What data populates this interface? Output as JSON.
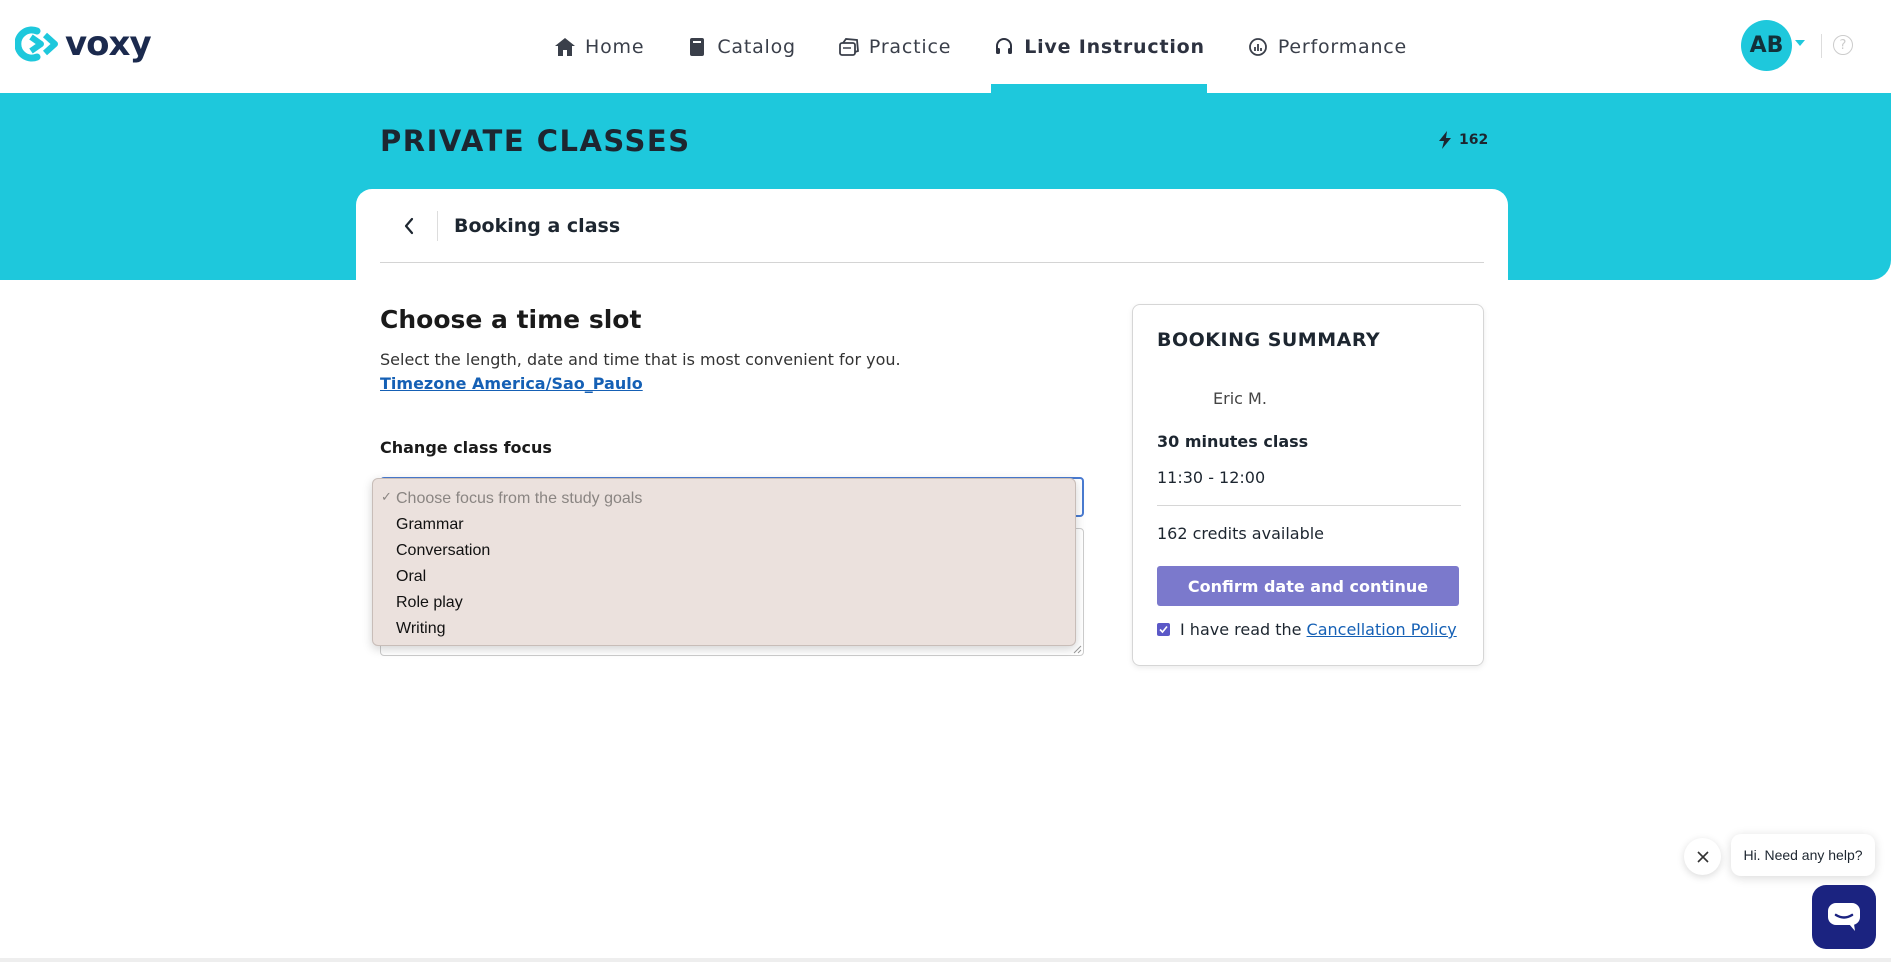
{
  "brand": {
    "name": "voxy",
    "color": "#1b2a4e",
    "accent": "#1ec8dc"
  },
  "nav": {
    "items": [
      {
        "label": "Home",
        "icon": "home-icon"
      },
      {
        "label": "Catalog",
        "icon": "book-icon"
      },
      {
        "label": "Practice",
        "icon": "practice-icon"
      },
      {
        "label": "Live Instruction",
        "icon": "headset-icon",
        "active": true
      },
      {
        "label": "Performance",
        "icon": "chart-icon"
      }
    ]
  },
  "user": {
    "initials": "AB"
  },
  "header": {
    "title": "PRIVATE CLASSES",
    "credits": "162"
  },
  "card": {
    "title": "Booking a class"
  },
  "main": {
    "section_title": "Choose a time slot",
    "description": "Select the length, date and time that is most convenient for you.",
    "timezone_link": "Timezone America/Sao_Paulo",
    "focus_label": "Change class focus",
    "focus_options": [
      {
        "label": "Choose focus from the study goals",
        "selected": true,
        "placeholder": true
      },
      {
        "label": "Grammar"
      },
      {
        "label": "Conversation"
      },
      {
        "label": "Oral"
      },
      {
        "label": "Role play"
      },
      {
        "label": "Writing"
      }
    ]
  },
  "summary": {
    "title": "BOOKING SUMMARY",
    "teacher": "Eric M.",
    "class_length": "30 minutes class",
    "time": "11:30 - 12:00",
    "credits_available": "162 credits available",
    "confirm_label": "Confirm date and continue",
    "policy_prefix": "I have read the",
    "policy_link": "Cancellation Policy",
    "policy_checked": true,
    "button_color": "#7b79cc"
  },
  "chat": {
    "bubble_text": "Hi. Need any help?",
    "button_color": "#1b2380"
  }
}
